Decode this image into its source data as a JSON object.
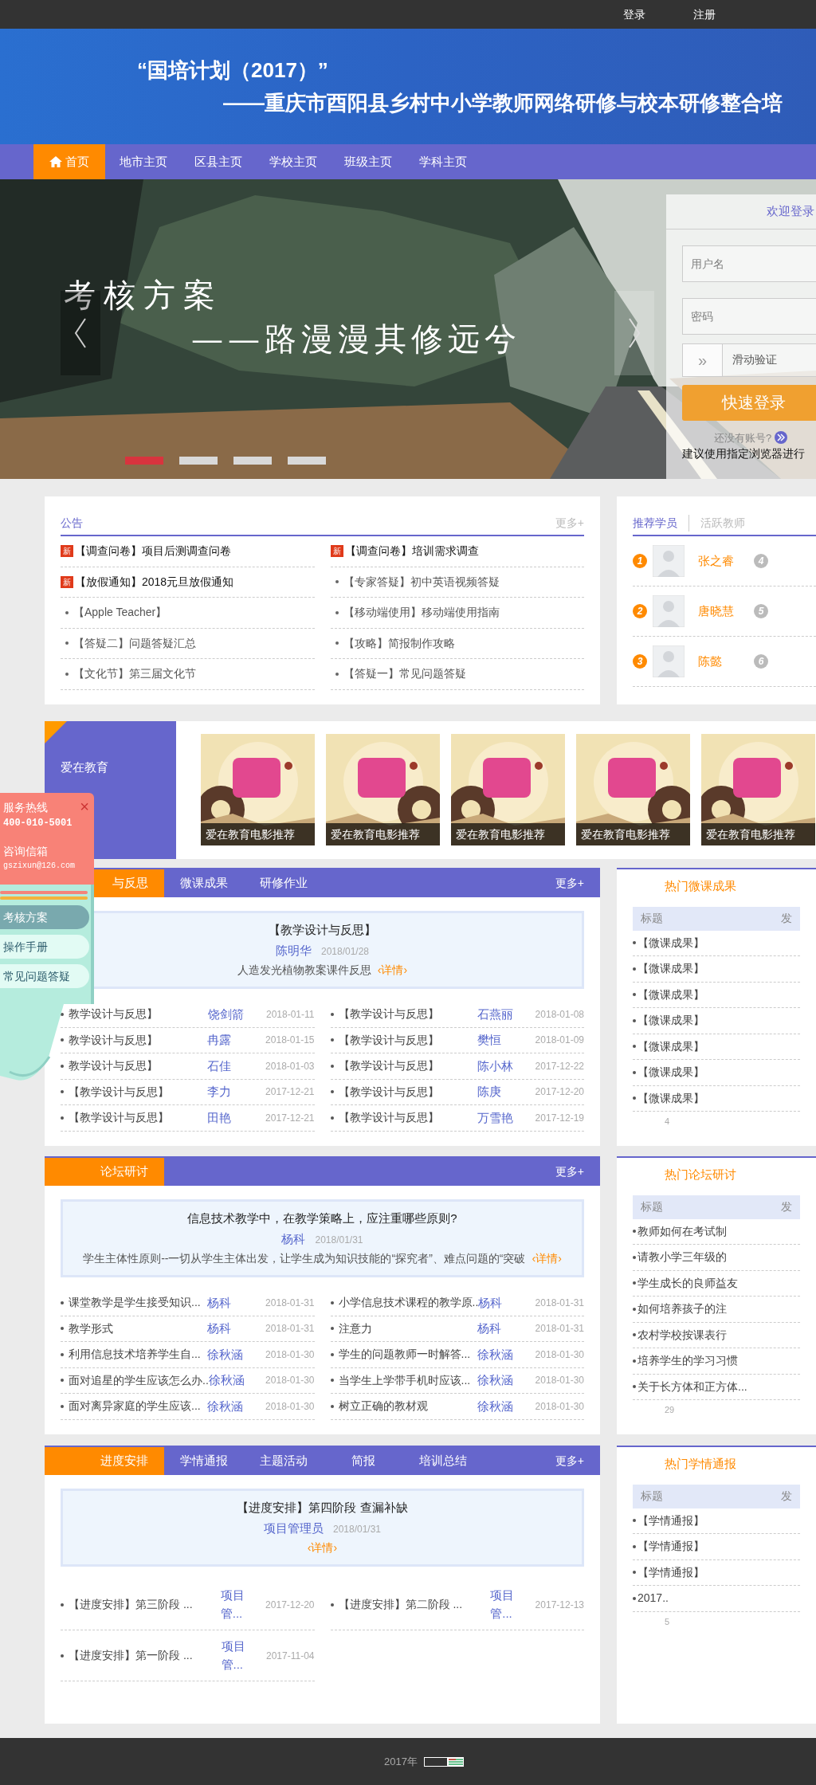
{
  "top_bar": {
    "links": [
      "登录",
      "注册"
    ]
  },
  "banner": {
    "title": "“国培计划（2017）”",
    "subtitle": "——重庆市酉阳县乡村中小学教师网络研修与校本研修整合培"
  },
  "nav": [
    {
      "label": "首页",
      "selected": true
    },
    {
      "label": "地市主页",
      "selected": false
    },
    {
      "label": "区县主页",
      "selected": false
    },
    {
      "label": "学校主页",
      "selected": false
    },
    {
      "label": "班级主页",
      "selected": false
    },
    {
      "label": "学科主页",
      "selected": false
    }
  ],
  "slider": {
    "heading": "考核方案",
    "subheading": "——路漫漫其修远兮",
    "dots": [
      {
        "selected": true
      },
      {
        "selected": false
      },
      {
        "selected": false
      },
      {
        "selected": false
      }
    ]
  },
  "login": {
    "title": "欢迎登录",
    "username_placeholder": "用户名",
    "password_placeholder": "密码",
    "verify_handle": "»",
    "verify": "滑动验证",
    "submit": "快速登录",
    "register": "还没有账号?",
    "browser_tip": "建议使用指定浏览器进行"
  },
  "notices": {
    "title": "公告",
    "more": "更多+",
    "items": [
      {
        "kind": "new",
        "text": "【调查问卷】项目后测调查问卷",
        "badge": "新"
      },
      {
        "kind": "new",
        "text": "【调查问卷】培训需求调查",
        "badge": "新"
      },
      {
        "kind": "new",
        "text": "【放假通知】2018元旦放假通知",
        "badge": "新"
      },
      {
        "kind": "dot",
        "text": "【专家答疑】初中英语视频答疑"
      },
      {
        "kind": "dot",
        "text": "【Apple Teacher】"
      },
      {
        "kind": "dot",
        "text": "【移动端使用】移动端使用指南"
      },
      {
        "kind": "dot",
        "text": "【答疑二】问题答疑汇总"
      },
      {
        "kind": "dot",
        "text": "【攻略】简报制作攻略"
      },
      {
        "kind": "dot",
        "text": "【文化节】第三届文化节"
      },
      {
        "kind": "dot",
        "text": "【答疑一】常见问题答疑"
      }
    ]
  },
  "recommend": {
    "tabs": [
      {
        "label": "推荐学员",
        "selected": true
      },
      {
        "label": "活跃教师",
        "selected": false
      }
    ],
    "students": [
      {
        "rank": "1",
        "name": "张之睿",
        "next_rank": "4"
      },
      {
        "rank": "2",
        "name": "唐晓慧",
        "next_rank": "5"
      },
      {
        "rank": "3",
        "name": "陈懿",
        "next_rank": "6"
      }
    ]
  },
  "movies": {
    "title": "爱在教育",
    "items": [
      {
        "caption": "爱在教育电影推荐"
      },
      {
        "caption": "爱在教育电影推荐"
      },
      {
        "caption": "爱在教育电影推荐"
      },
      {
        "caption": "爱在教育电影推荐"
      },
      {
        "caption": "爱在教育电影推荐"
      }
    ]
  },
  "sections": [
    {
      "tabs": [
        {
          "label": "与反思",
          "selected": true
        },
        {
          "label": "微课成果",
          "selected": false
        },
        {
          "label": "研修作业",
          "selected": false
        }
      ],
      "more": "更多+",
      "featured": {
        "title": "【教学设计与反思】",
        "author": "陈明华",
        "date": "2018/01/28",
        "summary": "人造发光植物教案课件反思",
        "detail": "‹详情›"
      },
      "rows": [
        {
          "title": "教学设计与反思】",
          "author": "饶剑箭",
          "date": "2018-01-11"
        },
        {
          "title": "【教学设计与反思】",
          "author": "石燕丽",
          "date": "2018-01-08"
        },
        {
          "title": "教学设计与反思】",
          "author": "冉露",
          "date": "2018-01-15"
        },
        {
          "title": "【教学设计与反思】",
          "author": "樊恒",
          "date": "2018-01-09"
        },
        {
          "title": "教学设计与反思】",
          "author": "石佳",
          "date": "2018-01-03"
        },
        {
          "title": "【教学设计与反思】",
          "author": "陈小林",
          "date": "2017-12-22"
        },
        {
          "title": "【教学设计与反思】",
          "author": "李力",
          "date": "2017-12-21"
        },
        {
          "title": "【教学设计与反思】",
          "author": "陈庚",
          "date": "2017-12-20"
        },
        {
          "title": "【教学设计与反思】",
          "author": "田艳",
          "date": "2017-12-21"
        },
        {
          "title": "【教学设计与反思】",
          "author": "万雪艳",
          "date": "2017-12-19"
        }
      ],
      "side": {
        "title": "热门微课成果",
        "header": [
          "标题",
          "发"
        ],
        "items": [
          "【微课成果】",
          "【微课成果】",
          "【微课成果】",
          "【微课成果】",
          "【微课成果】",
          "【微课成果】",
          "【微课成果】"
        ],
        "pager": "4"
      }
    },
    {
      "tabs": [
        {
          "label": "论坛研讨",
          "selected": true
        }
      ],
      "more": "更多+",
      "featured": {
        "title": "信息技术教学中，在教学策略上，应注重哪些原则?",
        "author": "杨科",
        "date": "2018/01/31",
        "summary": "学生主体性原则--一切从学生主体出发，让学生成为知识技能的“探究者”、难点问题的“突破",
        "detail": "‹详情›"
      },
      "rows": [
        {
          "title": "课堂教学是学生接受知识...",
          "author": "杨科",
          "date": "2018-01-31"
        },
        {
          "title": "小学信息技术课程的教学原..",
          "author": "杨科",
          "date": "2018-01-31"
        },
        {
          "title": "教学形式",
          "author": "杨科",
          "date": "2018-01-31"
        },
        {
          "title": "注意力",
          "author": "杨科",
          "date": "2018-01-31"
        },
        {
          "title": "利用信息技术培养学生自...",
          "author": "徐秋涵",
          "date": "2018-01-30"
        },
        {
          "title": "学生的问题教师一时解答...",
          "author": "徐秋涵",
          "date": "2018-01-30"
        },
        {
          "title": "面对追星的学生应该怎么办..",
          "author": "徐秋涵",
          "date": "2018-01-30"
        },
        {
          "title": "当学生上学带手机时应该...",
          "author": "徐秋涵",
          "date": "2018-01-30"
        },
        {
          "title": "面对离异家庭的学生应该...",
          "author": "徐秋涵",
          "date": "2018-01-30"
        },
        {
          "title": "树立正确的教材观",
          "author": "徐秋涵",
          "date": "2018-01-30"
        }
      ],
      "side": {
        "title": "热门论坛研讨",
        "header": [
          "标题",
          "发"
        ],
        "items": [
          "教师如何在考试制",
          "请教小学三年级的",
          "学生成长的良师益友",
          "如何培养孩子的注",
          "农村学校按课表行",
          "培养学生的学习习惯",
          "关于长方体和正方体..."
        ],
        "pager": "29"
      }
    },
    {
      "tabs": [
        {
          "label": "进度安排",
          "selected": true
        },
        {
          "label": "学情通报",
          "selected": false
        },
        {
          "label": "主题活动",
          "selected": false
        },
        {
          "label": "简报",
          "selected": false
        },
        {
          "label": "培训总结",
          "selected": false
        }
      ],
      "more": "更多+",
      "featured": {
        "title": "【进度安排】第四阶段  查漏补缺",
        "author": "项目管理员",
        "date": "2018/01/31",
        "detail": "‹详情›"
      },
      "rows": [
        {
          "title": "【进度安排】第三阶段 ...",
          "author": "项目管...",
          "date": "2017-12-20"
        },
        {
          "title": "【进度安排】第二阶段 ...",
          "author": "项目管...",
          "date": "2017-12-13"
        },
        {
          "title": "【进度安排】第一阶段 ...",
          "author": "项目管...",
          "date": "2017-11-04"
        }
      ],
      "side": {
        "title": "热门学情通报",
        "header": [
          "标题",
          "发"
        ],
        "items": [
          "【学情通报】",
          "【学情通报】",
          "【学情通报】",
          "2017.."
        ],
        "pager": "5"
      }
    }
  ],
  "float_widget": {
    "hotline_label": "服务热线",
    "hotline": "400-010-5001",
    "close": "×",
    "mail_label": "咨询信箱",
    "mail": "gszixun@126.com",
    "links": [
      {
        "label": "考核方案",
        "selected": true
      },
      {
        "label": "操作手册",
        "selected": false
      },
      {
        "label": "常见问题答疑",
        "selected": false
      }
    ]
  },
  "footer": {
    "text": "2017年"
  }
}
